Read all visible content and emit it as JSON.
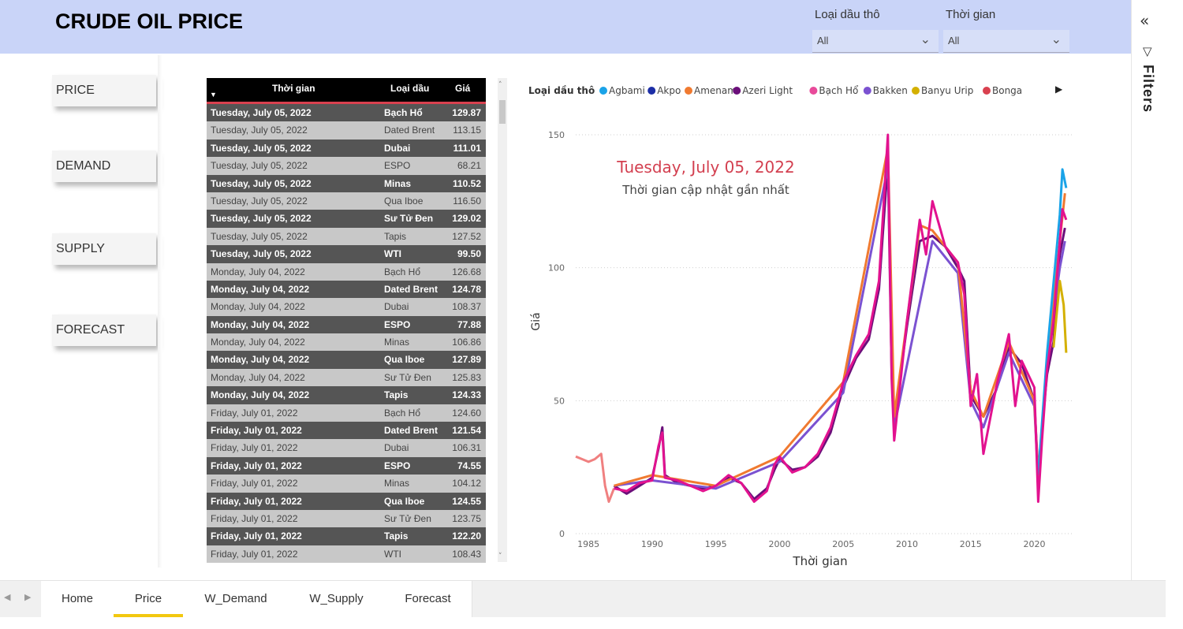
{
  "header": {
    "title": "CRUDE OIL PRICE"
  },
  "filters": {
    "oil_type": {
      "label": "Loại dầu thô",
      "value": "All"
    },
    "time": {
      "label": "Thời gian",
      "value": "All"
    }
  },
  "filters_pane": {
    "label": "Filters"
  },
  "nav_buttons": [
    "PRICE",
    "DEMAND",
    "SUPPLY",
    "FORECAST"
  ],
  "table": {
    "headers": [
      "Thời gian",
      "Loại dầu",
      "Giá"
    ],
    "rows": [
      [
        "Tuesday, July 05, 2022",
        "Bạch Hổ",
        "129.87"
      ],
      [
        "Tuesday, July 05, 2022",
        "Dated Brent",
        "113.15"
      ],
      [
        "Tuesday, July 05, 2022",
        "Dubai",
        "111.01"
      ],
      [
        "Tuesday, July 05, 2022",
        "ESPO",
        "68.21"
      ],
      [
        "Tuesday, July 05, 2022",
        "Minas",
        "110.52"
      ],
      [
        "Tuesday, July 05, 2022",
        "Qua Iboe",
        "116.50"
      ],
      [
        "Tuesday, July 05, 2022",
        "Sư Tử Đen",
        "129.02"
      ],
      [
        "Tuesday, July 05, 2022",
        "Tapis",
        "127.52"
      ],
      [
        "Tuesday, July 05, 2022",
        "WTI",
        "99.50"
      ],
      [
        "Monday, July 04, 2022",
        "Bạch Hổ",
        "126.68"
      ],
      [
        "Monday, July 04, 2022",
        "Dated Brent",
        "124.78"
      ],
      [
        "Monday, July 04, 2022",
        "Dubai",
        "108.37"
      ],
      [
        "Monday, July 04, 2022",
        "ESPO",
        "77.88"
      ],
      [
        "Monday, July 04, 2022",
        "Minas",
        "106.86"
      ],
      [
        "Monday, July 04, 2022",
        "Qua Iboe",
        "127.89"
      ],
      [
        "Monday, July 04, 2022",
        "Sư Tử Đen",
        "125.83"
      ],
      [
        "Monday, July 04, 2022",
        "Tapis",
        "124.33"
      ],
      [
        "Friday, July 01, 2022",
        "Bạch Hổ",
        "124.60"
      ],
      [
        "Friday, July 01, 2022",
        "Dated Brent",
        "121.54"
      ],
      [
        "Friday, July 01, 2022",
        "Dubai",
        "106.31"
      ],
      [
        "Friday, July 01, 2022",
        "ESPO",
        "74.55"
      ],
      [
        "Friday, July 01, 2022",
        "Minas",
        "104.12"
      ],
      [
        "Friday, July 01, 2022",
        "Qua Iboe",
        "124.55"
      ],
      [
        "Friday, July 01, 2022",
        "Sư Tử Đen",
        "123.75"
      ],
      [
        "Friday, July 01, 2022",
        "Tapis",
        "122.20"
      ],
      [
        "Friday, July 01, 2022",
        "WTI",
        "108.43"
      ]
    ]
  },
  "latest_card": {
    "date": "Tuesday, July 05, 2022",
    "subtitle": "Thời gian cập nhật gần nhất"
  },
  "colors": {
    "accent": "#d9414f",
    "header_bg": "#c9d4f8",
    "tab_active": "#f2c80f"
  },
  "chart_data": {
    "type": "line",
    "xlabel": "Thời gian",
    "ylabel": "Giá",
    "xlim": [
      1984,
      2023
    ],
    "ylim": [
      0,
      150
    ],
    "x_ticks": [
      1985,
      1990,
      1995,
      2000,
      2005,
      2010,
      2015,
      2020
    ],
    "y_ticks": [
      0,
      50,
      100,
      150
    ],
    "grid": true,
    "legend": {
      "title": "Loại dầu thô",
      "position": "top",
      "items": [
        {
          "name": "Agbami",
          "color": "#1aa3e8"
        },
        {
          "name": "Akpo",
          "color": "#1c2ea6"
        },
        {
          "name": "Amenam",
          "color": "#f07a30"
        },
        {
          "name": "Azeri Light",
          "color": "#6b0f7a"
        },
        {
          "name": "Bạch Hổ",
          "color": "#e84a9a"
        },
        {
          "name": "Bakken",
          "color": "#7b52d1"
        },
        {
          "name": "Banyu Urip",
          "color": "#d4b000"
        },
        {
          "name": "Bonga",
          "color": "#d9414f"
        }
      ]
    },
    "series": [
      {
        "color": "#f08080",
        "x": [
          1984.0,
          1984.5,
          1985.0,
          1985.5,
          1986.0,
          1986.3,
          1986.6,
          1987.0
        ],
        "y": [
          29,
          28,
          27,
          28,
          30,
          18,
          12,
          17
        ]
      },
      {
        "color": "#6b0f7a",
        "x": [
          1987.0,
          1988.0,
          1989.0,
          1990.0,
          1990.5,
          1990.8,
          1991.0,
          1992.0,
          1993.0,
          1994.0,
          1995.0,
          1996.0,
          1997.0,
          1998.0,
          1999.0,
          1999.6,
          2000.0,
          2001.0,
          2002.0,
          2003.0,
          2004.0,
          2005.0,
          2006.0,
          2007.0,
          2007.8,
          2008.5,
          2008.8,
          2009.0,
          2010.0,
          2011.0,
          2012.0,
          2013.0,
          2014.0,
          2014.5,
          2015.0,
          2016.0,
          2017.0,
          2018.0,
          2019.0,
          2020.0,
          2020.3,
          2020.6,
          2021.0,
          2021.5,
          2022.0,
          2022.4
        ],
        "y": [
          18,
          15,
          18,
          21,
          32,
          40,
          22,
          19,
          18,
          17,
          18,
          21,
          19,
          13,
          17,
          24,
          28,
          24,
          25,
          29,
          38,
          55,
          66,
          73,
          92,
          140,
          60,
          42,
          78,
          110,
          112,
          108,
          100,
          95,
          52,
          44,
          54,
          70,
          64,
          50,
          22,
          40,
          60,
          72,
          105,
          115
        ]
      },
      {
        "color": "#7b52d1",
        "x": [
          1987.0,
          1990.0,
          1995.0,
          2000.0,
          2005.0,
          2008.5,
          2009.0,
          2012.0,
          2014.0,
          2015.0,
          2016.0,
          2018.0,
          2020.0,
          2020.3,
          2021.0,
          2022.0,
          2022.4
        ],
        "y": [
          18,
          20,
          17,
          27,
          53,
          138,
          40,
          110,
          98,
          50,
          40,
          68,
          48,
          20,
          65,
          100,
          110
        ]
      },
      {
        "color": "#f07a30",
        "x": [
          1987.0,
          1990.0,
          1995.0,
          2000.0,
          2005.0,
          2008.5,
          2009.0,
          2011.0,
          2012.0,
          2014.0,
          2015.0,
          2016.0,
          2018.0,
          2020.0,
          2020.3,
          2021.0,
          2022.0,
          2022.4
        ],
        "y": [
          18,
          22,
          18,
          29,
          57,
          145,
          44,
          116,
          114,
          102,
          54,
          44,
          72,
          50,
          20,
          64,
          110,
          128
        ]
      },
      {
        "color": "#1aa3e8",
        "x": [
          2020.3,
          2021.0,
          2022.0,
          2022.2,
          2022.5
        ],
        "y": [
          22,
          68,
          120,
          137,
          130
        ]
      },
      {
        "color": "#d4b000",
        "x": [
          2021.5,
          2022.0,
          2022.3,
          2022.5
        ],
        "y": [
          70,
          95,
          86,
          68
        ]
      },
      {
        "color": "#e2128f",
        "x": [
          1987.0,
          1988.0,
          1989.0,
          1990.0,
          1990.5,
          1990.8,
          1991.0,
          1992.0,
          1993.0,
          1994.0,
          1995.0,
          1996.0,
          1997.0,
          1998.0,
          1999.0,
          1999.6,
          2000.0,
          2001.0,
          2002.0,
          2003.0,
          2004.0,
          2005.0,
          2006.0,
          2007.0,
          2007.8,
          2008.5,
          2008.8,
          2009.0,
          2010.0,
          2011.0,
          2011.5,
          2012.0,
          2013.0,
          2014.0,
          2014.5,
          2015.0,
          2015.5,
          2016.0,
          2017.0,
          2018.0,
          2018.5,
          2019.0,
          2020.0,
          2020.3,
          2020.6,
          2021.0,
          2021.5,
          2022.0,
          2022.2,
          2022.5
        ],
        "y": [
          17,
          16,
          19,
          20,
          33,
          38,
          21,
          20,
          18,
          16,
          18,
          22,
          19,
          12,
          16,
          26,
          29,
          23,
          25,
          30,
          40,
          57,
          67,
          75,
          95,
          150,
          58,
          35,
          80,
          118,
          105,
          125,
          108,
          102,
          90,
          48,
          60,
          30,
          55,
          75,
          48,
          65,
          55,
          12,
          35,
          62,
          80,
          110,
          122,
          118
        ]
      }
    ]
  },
  "tabs": [
    "Home",
    "Price",
    "W_Demand",
    "W_Supply",
    "Forecast"
  ],
  "active_tab": "Price"
}
